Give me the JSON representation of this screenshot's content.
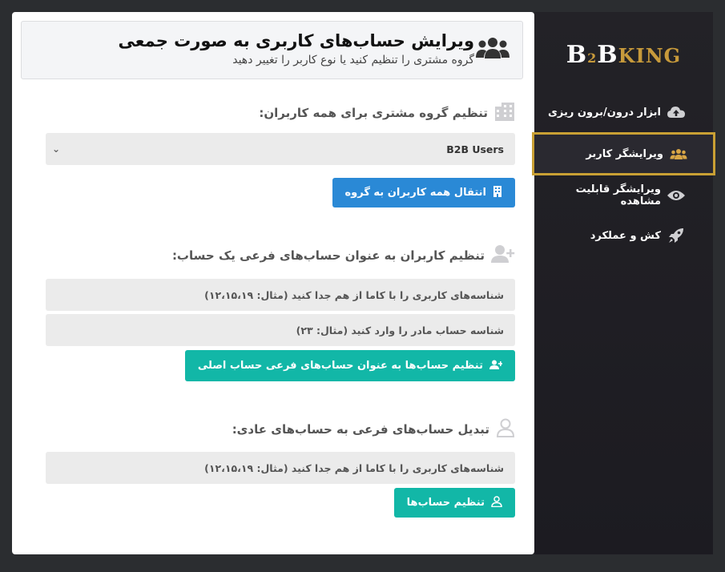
{
  "sidebar": {
    "logo": {
      "b1": "B",
      "two": "2",
      "b2": "B",
      "king": "KING"
    },
    "items": [
      {
        "label": "ابزار درون/برون ریزی",
        "icon": "cloud-upload-icon"
      },
      {
        "label": "ویرایشگر کاربر",
        "icon": "users-icon",
        "active": true
      },
      {
        "label": "ویرایشگر قابلیت مشاهده",
        "icon": "eye-icon"
      },
      {
        "label": "کش و عملکرد",
        "icon": "rocket-icon"
      }
    ],
    "accent": "#c9a034"
  },
  "header": {
    "title": "ویرایش حساب‌های کاربری به صورت جمعی",
    "subtitle": "گروه مشتری را تنظیم کنید یا نوع کاربر را تغییر دهید",
    "icon": "users-icon"
  },
  "group_section": {
    "title": "تنظیم گروه مشتری برای همه کاربران:",
    "icon": "building-icon",
    "select_value": "B2B Users",
    "button_label": "انتقال همه کاربران به گروه"
  },
  "subaccount_section": {
    "title": "تنظیم کاربران به عنوان حساب‌های فرعی یک حساب:",
    "icon": "user-plus-icon",
    "ids_placeholder": "شناسه‌های کاربری را با کاما از هم جدا کنید (مثال: ۱۲،۱۵،۱۹)",
    "parent_placeholder": "شناسه حساب مادر را وارد کنید (مثال: ۲۳)",
    "button_label": "تنظیم حساب‌ها به عنوان حساب‌های فرعی حساب اصلی"
  },
  "convert_section": {
    "title": "تبدیل حساب‌های فرعی به حساب‌های عادی:",
    "icon": "user-icon",
    "ids_placeholder": "شناسه‌های کاربری را با کاما از هم جدا کنید (مثال: ۱۲،۱۵،۱۹)",
    "button_label": "تنظیم حساب‌ها"
  },
  "colors": {
    "blue_button": "#2a89d6",
    "teal_button": "#12b7a7"
  }
}
